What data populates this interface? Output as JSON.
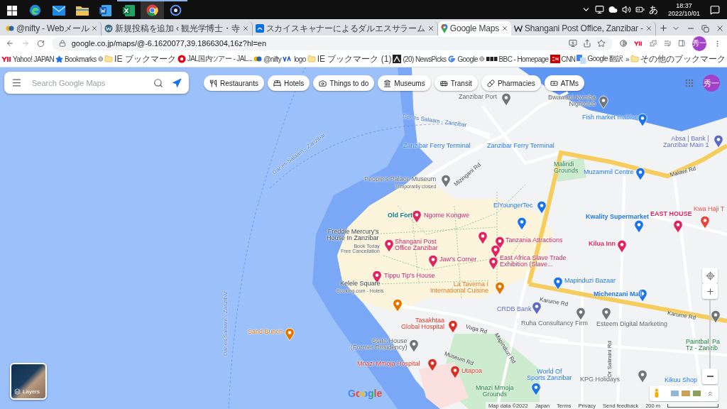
{
  "taskbar": {
    "apps": [
      {
        "kind": "start",
        "running": false,
        "selected": false
      },
      {
        "kind": "edge",
        "running": false,
        "selected": false
      },
      {
        "kind": "mail",
        "running": false,
        "selected": false
      },
      {
        "kind": "folder",
        "running": false,
        "selected": false
      },
      {
        "kind": "word",
        "running": false,
        "selected": false
      },
      {
        "kind": "excel",
        "running": true,
        "selected": false
      },
      {
        "kind": "chrome",
        "running": true,
        "selected": true
      },
      {
        "kind": "app",
        "running": true,
        "selected": false
      }
    ],
    "tray": {
      "ime": "あ",
      "time": "18:37",
      "date": "2022/10/01"
    }
  },
  "browser": {
    "tabs": [
      {
        "kind": "nifty",
        "title": "@nifty - Webメール",
        "selected": false
      },
      {
        "kind": "wordpress",
        "title": "新規投稿を追加 ‹ 観光学博士・寺",
        "selected": false
      },
      {
        "kind": "sky",
        "title": "スカイスキャナーによるダルエスサラーム",
        "selected": false
      },
      {
        "kind": "maps",
        "title": "Google Maps",
        "selected": true
      },
      {
        "kind": "wiki",
        "title": "Shangani Post Office, Zanzibar -",
        "selected": false
      }
    ],
    "address": "google.co.jp/maps/@-6.1620077,39.1866304,16z?hl=en",
    "profile": "秀一",
    "bookmarks": [
      {
        "kind": "yahoo",
        "label": "Yahoo! JAPAN"
      },
      {
        "kind": "star",
        "label": "Bookmarks"
      },
      {
        "kind": "globe"
      },
      {
        "kind": "folder",
        "label": "IE ブックマーク"
      },
      {
        "kind": "jal",
        "label": "JAL国内ツアー - JAL..."
      },
      {
        "kind": "nifty",
        "label": "@nifty"
      },
      {
        "kind": "logo",
        "label": "logo"
      },
      {
        "kind": "folder",
        "label": "IE ブックマーク (1)"
      },
      {
        "kind": "newspicks",
        "label": "(20) NewsPicks"
      },
      {
        "kind": "google",
        "label": "Google"
      },
      {
        "kind": "globe"
      },
      {
        "kind": "bbc",
        "label": "BBC - Homepage"
      },
      {
        "kind": "cnn",
        "label": "CNN"
      },
      {
        "kind": "translate",
        "label": "Google 翻訳"
      }
    ],
    "more": "»",
    "other_bookmarks": "その他のブックマーク"
  },
  "maps": {
    "search": {
      "placeholder": "Search Google Maps"
    },
    "chips": [
      {
        "kind": "food",
        "label": "Restaurants"
      },
      {
        "kind": "hotel",
        "label": "Hotels"
      },
      {
        "kind": "activity",
        "label": "Things to do"
      },
      {
        "kind": "museum",
        "label": "Museums"
      },
      {
        "kind": "transit",
        "label": "Transit"
      },
      {
        "kind": "pharmacy",
        "label": "Pharmacies"
      },
      {
        "kind": "atm",
        "label": "ATMs"
      }
    ],
    "account": "秀一",
    "labels": [
      {
        "kind": "water",
        "lines": [
          "Dar es Salaam - Zanzibar"
        ]
      },
      {
        "kind": "water",
        "lines": [
          "Dar es Salaam - Zanzibar"
        ]
      },
      {
        "kind": "water",
        "lines": [
          "Dar es Salaam - Zanzibar"
        ]
      },
      {
        "kind": "poi",
        "lines": [
          "Zanzibar Port"
        ]
      },
      {
        "kind": "poi",
        "lines": [
          "Bwawani Komba",
          "Nightclub"
        ]
      },
      {
        "kind": "shop",
        "lines": [
          "Fish market mablue"
        ]
      },
      {
        "kind": "shop",
        "lines": [
          "Zanzibar Ferry Terminal"
        ]
      },
      {
        "kind": "shop",
        "lines": [
          "Zanzibar Ferry Terminal"
        ]
      },
      {
        "kind": "bank",
        "lines": [
          "Absa | Bank |",
          "Zanzibar Main 1"
        ]
      },
      {
        "kind": "park",
        "lines": [
          "Malindi",
          "Grounds"
        ]
      },
      {
        "kind": "shop",
        "lines": [
          "Muzammil Centre"
        ]
      },
      {
        "kind": "road",
        "lines": [
          "Malawi Rd"
        ]
      },
      {
        "kind": "road",
        "lines": [
          "Mizingani Rd"
        ]
      },
      {
        "kind": "poi",
        "lines": [
          "People's Palace Museum"
        ]
      },
      {
        "kind": "sub",
        "lines": [
          "Temporarily closed"
        ]
      },
      {
        "kind": "shop",
        "lines": [
          "ElYoungerTec"
        ]
      },
      {
        "kind": "landmark",
        "lines": [
          "Old Fort"
        ]
      },
      {
        "kind": "attraction",
        "lines": [
          "Ngome Kongwe"
        ]
      },
      {
        "kind": "shopbold",
        "lines": [
          "Kwality Supermarket"
        ]
      },
      {
        "kind": "hotel",
        "lines": [
          "EAST HOUSE"
        ]
      },
      {
        "kind": "red",
        "lines": [
          "Kwa Haji T"
        ]
      },
      {
        "kind": "place",
        "lines": [
          "Freddie Mercury's",
          "House In Zanzibar"
        ]
      },
      {
        "kind": "sub",
        "lines": [
          "Book Today",
          "Free Cancellation"
        ]
      },
      {
        "kind": "attraction",
        "lines": [
          "Shangani Post",
          "Office Zanzibar"
        ]
      },
      {
        "kind": "attraction",
        "lines": [
          "Tanzania Attractions"
        ]
      },
      {
        "kind": "hotel",
        "lines": [
          "Kilua Inn"
        ]
      },
      {
        "kind": "attraction",
        "lines": [
          "Jaw's Corner"
        ]
      },
      {
        "kind": "attraction",
        "lines": [
          "East Africa Slave Trade",
          "Exhibition (Slave..."
        ]
      },
      {
        "kind": "attraction",
        "lines": [
          "Tippu Tip's House"
        ]
      },
      {
        "kind": "place",
        "lines": [
          "Kelele Square"
        ]
      },
      {
        "kind": "sub",
        "lines": [
          "Booking.com - Hotels"
        ]
      },
      {
        "kind": "shop",
        "lines": [
          "Mapinduzi Bazaar"
        ]
      },
      {
        "kind": "food",
        "lines": [
          "La Taverna I",
          "International Cuisine"
        ]
      },
      {
        "kind": "shopbold",
        "lines": [
          "Michenzani Mall"
        ]
      },
      {
        "kind": "road",
        "lines": [
          "Karume Rd"
        ]
      },
      {
        "kind": "road",
        "lines": [
          "Karume Rd"
        ]
      },
      {
        "kind": "bank",
        "lines": [
          "CRDB Bank"
        ]
      },
      {
        "kind": "poi",
        "lines": [
          "Ruha Consultancy Firm"
        ]
      },
      {
        "kind": "poi",
        "lines": [
          "Esteem Digital Marketing"
        ]
      },
      {
        "kind": "park",
        "lines": [
          "Paintball Pa",
          "Tz - Zanzib"
        ]
      },
      {
        "kind": "medical",
        "lines": [
          "Tasakhtaa",
          "Global Hospital"
        ]
      },
      {
        "kind": "road",
        "lines": [
          "Vuga Rd"
        ]
      },
      {
        "kind": "road",
        "lines": [
          "Mapinduzi Rd"
        ]
      },
      {
        "kind": "road",
        "lines": [
          "Dr Salimini Rd"
        ]
      },
      {
        "kind": "poi",
        "lines": [
          "State House",
          "(Former Residency)"
        ]
      },
      {
        "kind": "road",
        "lines": [
          "Museum Rd"
        ]
      },
      {
        "kind": "medical",
        "lines": [
          "Mnazi Mmoja Hospital"
        ]
      },
      {
        "kind": "medical",
        "lines": [
          "Utapoa"
        ]
      },
      {
        "kind": "shop",
        "lines": [
          "World Of",
          "Sports Zanzibar"
        ]
      },
      {
        "kind": "poi",
        "lines": [
          "KPG Holidays"
        ]
      },
      {
        "kind": "shop",
        "lines": [
          "Kikuu Shop"
        ]
      },
      {
        "kind": "park",
        "lines": [
          "Mnazi Mmoja",
          "Grounds"
        ]
      },
      {
        "kind": "food",
        "lines": [
          "Sand Bunch"
        ]
      }
    ],
    "layers": "Layers",
    "logo": "Google",
    "footer": [
      "Map data ©2022",
      "Japan",
      "Terms",
      "Privacy",
      "Send feedback"
    ],
    "scale": "200 m"
  }
}
